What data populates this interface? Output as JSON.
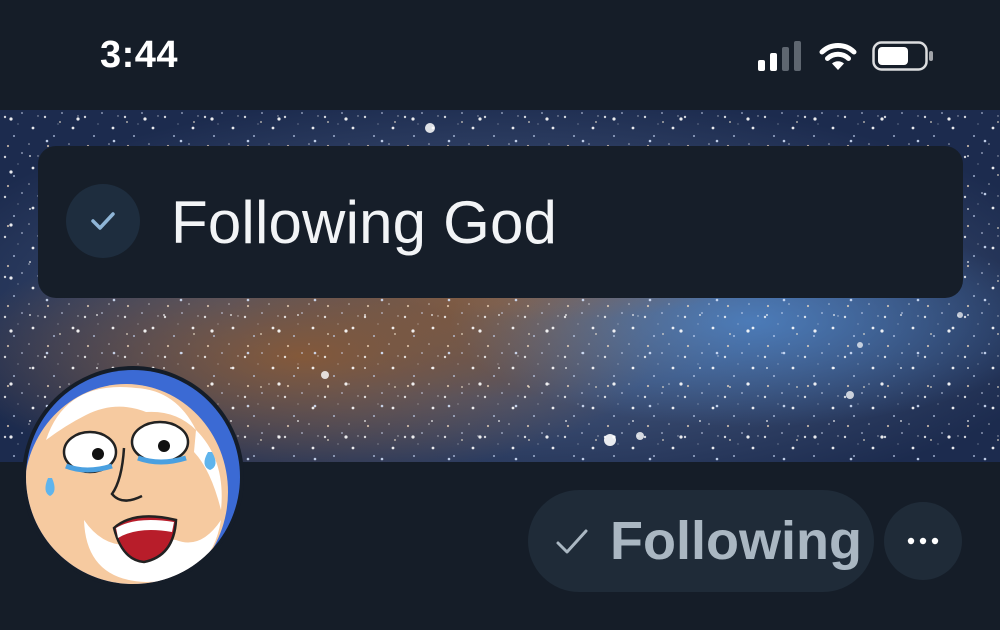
{
  "status_bar": {
    "time": "3:44",
    "icons": [
      "signal-icon",
      "wifi-icon",
      "battery-icon"
    ]
  },
  "banner": {
    "image": "galaxy-starfield"
  },
  "toast": {
    "icon": "check-icon",
    "message": "Following God"
  },
  "profile": {
    "avatar": "cartoon-old-man-avatar",
    "following_button": {
      "icon": "check-icon",
      "label": "Following"
    },
    "more_button": {
      "icon": "more-icon"
    }
  },
  "colors": {
    "background": "#151d28",
    "toast_background": "#161e29",
    "button_background": "#1f2b38",
    "button_text": "#aab7c2",
    "check_accent": "#8fb5d6"
  }
}
